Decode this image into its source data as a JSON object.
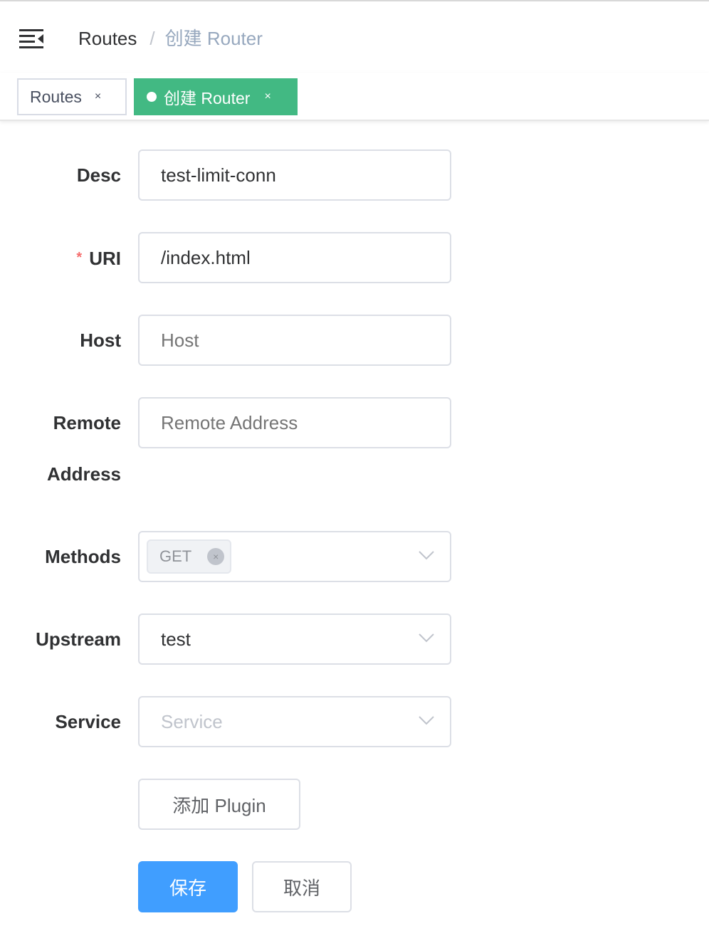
{
  "navbar": {
    "breadcrumb": {
      "parent": "Routes",
      "separator": "/",
      "current": "创建 Router"
    }
  },
  "tags": [
    {
      "label": "Routes",
      "close": "×",
      "active": false
    },
    {
      "label": "创建 Router",
      "close": "×",
      "active": true
    }
  ],
  "form": {
    "desc": {
      "label": "Desc",
      "value": "test-limit-conn",
      "placeholder": ""
    },
    "uri": {
      "label": "URI",
      "required_mark": "*",
      "value": "/index.html",
      "placeholder": ""
    },
    "host": {
      "label": "Host",
      "value": "",
      "placeholder": "Host"
    },
    "remote_address": {
      "label_line1": "Remote",
      "label_line2": "Address",
      "value": "",
      "placeholder": "Remote Address"
    },
    "methods": {
      "label": "Methods",
      "selected": [
        "GET"
      ],
      "remove_icon": "×"
    },
    "upstream": {
      "label": "Upstream",
      "value": "test"
    },
    "service": {
      "label": "Service",
      "value": "",
      "placeholder": "Service"
    },
    "add_plugin_label": "添加 Plugin",
    "save_label": "保存",
    "cancel_label": "取消"
  },
  "colors": {
    "active_tag": "#42b983",
    "primary": "#409eff",
    "required": "#f56c6c"
  },
  "icons": {
    "menu": "hamburger-icon",
    "dropdown": "chevron-down-icon",
    "close": "close-icon"
  }
}
